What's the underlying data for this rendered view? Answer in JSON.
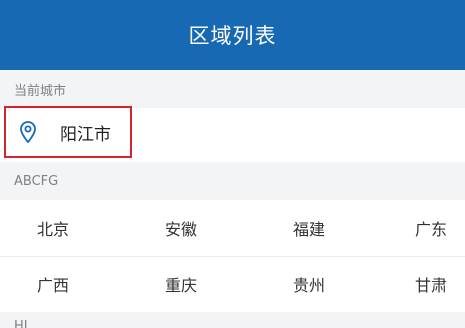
{
  "header": {
    "title": "区域列表"
  },
  "current_section": {
    "label": "当前城市",
    "city": "阳江市",
    "icon": "location-pin-icon",
    "highlight_color": "#d8232a"
  },
  "group_section": {
    "label": "ABCFG",
    "cities": [
      "北京",
      "安徽",
      "福建",
      "广东",
      "广西",
      "重庆",
      "贵州",
      "甘肃"
    ]
  },
  "next_group": {
    "label": "HJ"
  },
  "colors": {
    "header": "#1769b3",
    "background": "#f3f4f5",
    "icon": "#1769b3"
  }
}
